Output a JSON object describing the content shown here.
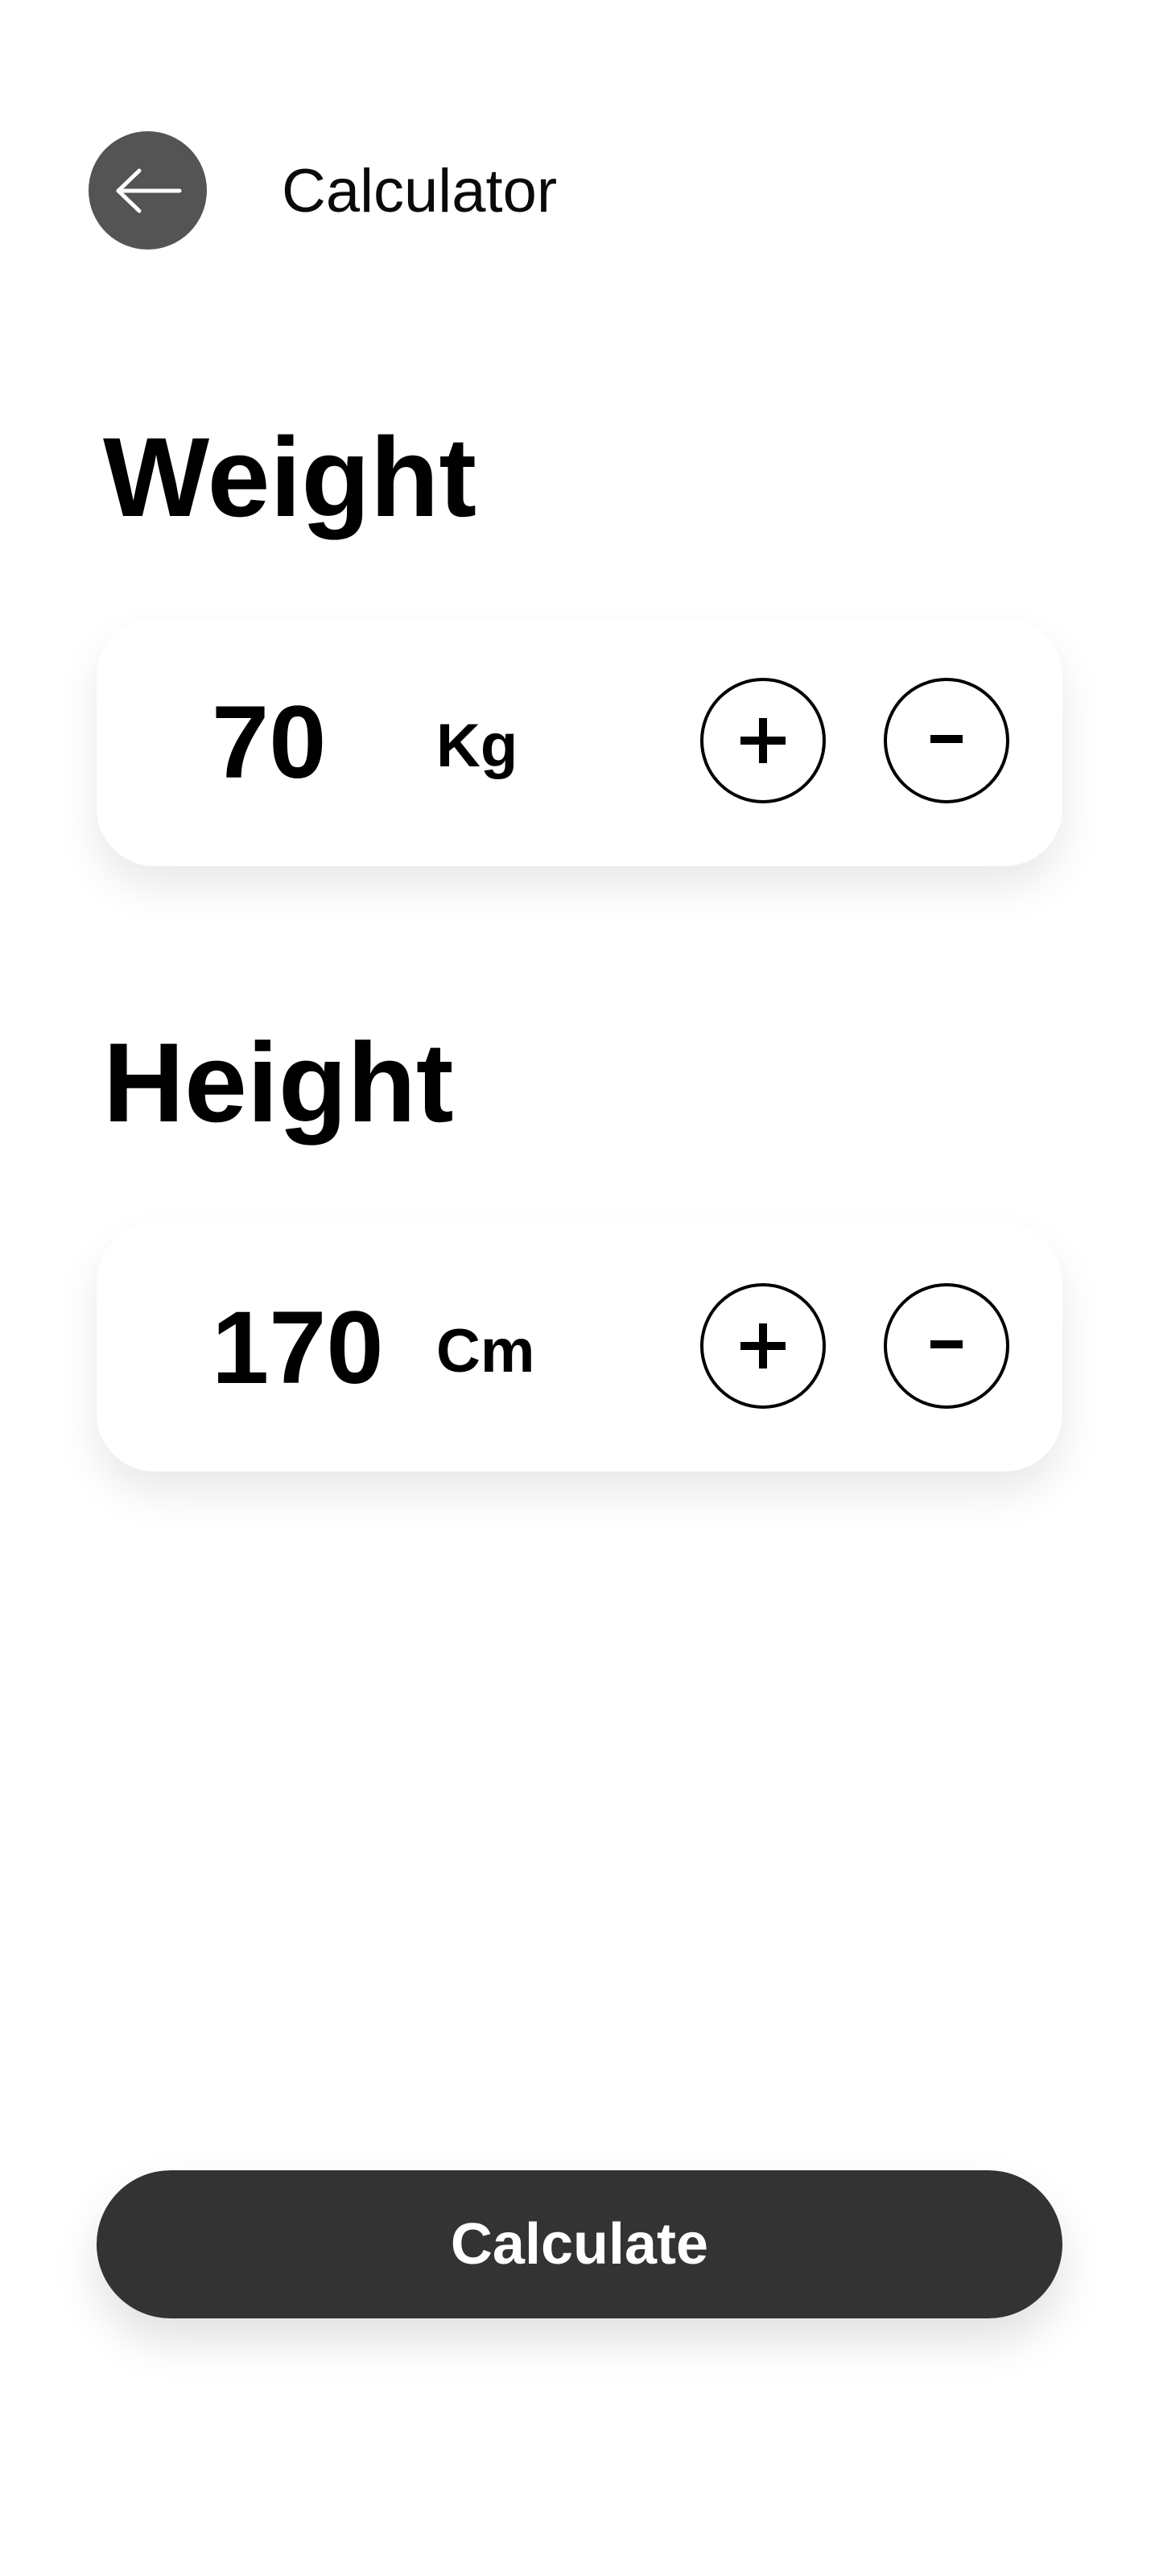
{
  "header": {
    "title": "Calculator",
    "back_icon": "arrow-left-icon"
  },
  "weight": {
    "heading": "Weight",
    "value": "70",
    "unit": "Kg",
    "increment_icon": "plus-icon",
    "decrement_icon": "minus-icon"
  },
  "height": {
    "heading": "Height",
    "value": "170",
    "unit": "Cm",
    "increment_icon": "plus-icon",
    "decrement_icon": "minus-icon"
  },
  "actions": {
    "calculate_label": "Calculate"
  },
  "colors": {
    "background": "#ffffff",
    "back_button": "#545454",
    "primary_button": "#333333",
    "text": "#000000"
  }
}
